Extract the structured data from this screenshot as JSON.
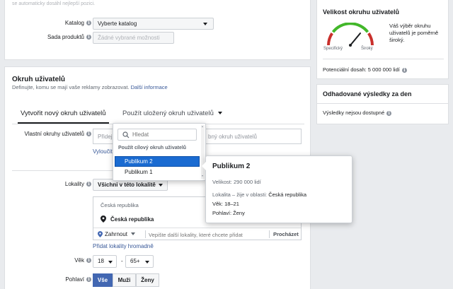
{
  "top_text": "se automaticky dosáhl nejlepší pozici.",
  "catalog": {
    "label": "Katalog",
    "select_value": "Vyberte katalog",
    "products_label": "Sada produktů",
    "products_placeholder": "Žádné vybrané možnosti"
  },
  "audience": {
    "title": "Okruh uživatelů",
    "desc": "Definujte, komu se mají vaše reklamy zobrazovat.",
    "more_link": "Další informace",
    "tab_new": "Vytvořit nový okruh uživatelů",
    "tab_saved": "Použít uložený okruh uživatelů",
    "custom_label": "Vlastní okruhy uživatelů",
    "custom_placeholder_left": "Přidej",
    "custom_placeholder_right": "bný okruh uživatelů",
    "exclude_link": "Vyloučit",
    "locations_label": "Lokality",
    "locations_select": "Všichni v této lokalitě",
    "loc_header": "Česká republika",
    "loc_item": "Česká republika",
    "include_select": "Zahrnout",
    "loc_placeholder": "Vepište další lokality, které chcete přidat",
    "browse": "Procházet",
    "bulk_link": "Přidat lokality hromadně",
    "age_label": "Věk",
    "age_from": "18",
    "age_to": "65+",
    "age_dash": "-",
    "gender_label": "Pohlaví",
    "gender_options": [
      "Vše",
      "Muži",
      "Ženy"
    ]
  },
  "dropdown": {
    "search_placeholder": "Hledat",
    "section_title": "Použít cílový okruh uživatelů",
    "items": [
      "Publikum 2",
      "Publikum 1"
    ]
  },
  "tooltip": {
    "title": "Publikum 2",
    "size": "Velikost: 290 000 lidí",
    "location": "Lokalita – žije v oblasti:",
    "location_value": "Česká republika",
    "age": "Věk: 18–21",
    "gender": "Pohlaví: Ženy"
  },
  "size_panel": {
    "title": "Velikost okruhu uživatelů",
    "gauge_text": "Váš výběr okruhu uživatelů je poměrně široký.",
    "specific": "Specifický",
    "broad": "Široký",
    "potential": "Potenciální dosah: 5 000 000 lidí",
    "gauge_level": 0.72
  },
  "results_panel": {
    "title": "Odhadované výsledky za den",
    "text": "Výsledky nejsou dostupné"
  },
  "colors": {
    "primary": "#4267b2",
    "selected_item": "#1a6bd1",
    "gauge_red": "#c9302c",
    "gauge_green": "#42b72a"
  }
}
